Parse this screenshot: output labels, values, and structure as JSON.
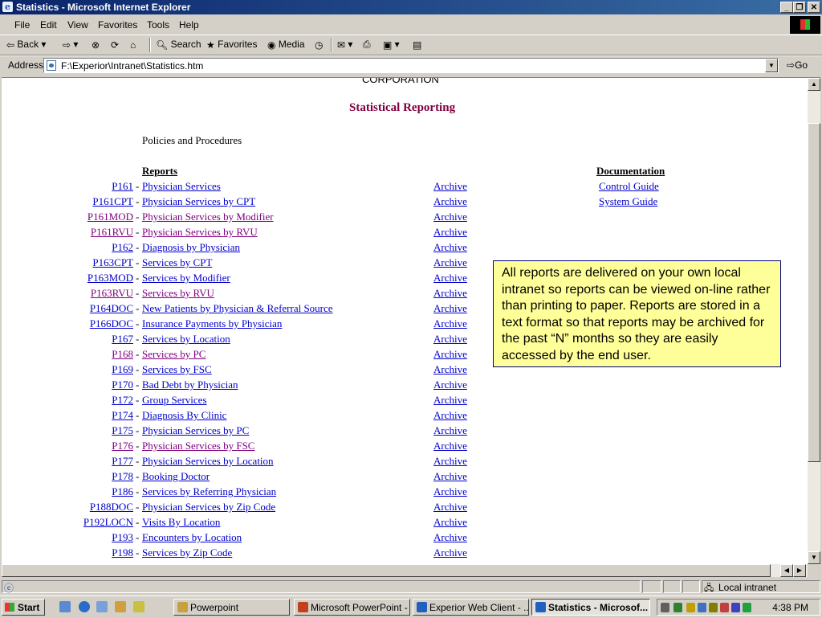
{
  "window": {
    "title": "Statistics - Microsoft Internet Explorer"
  },
  "menu": [
    "File",
    "Edit",
    "View",
    "Favorites",
    "Tools",
    "Help"
  ],
  "toolbar": {
    "back": "Back",
    "search": "Search",
    "favorites": "Favorites",
    "media": "Media"
  },
  "address": {
    "label": "Address",
    "value": "F:\\Experior\\Intranet\\Statistics.htm",
    "go": "Go"
  },
  "page": {
    "corporation": "CORPORATION",
    "title": "Statistical Reporting",
    "policies": "Policies and Procedures",
    "reports_header": "Reports",
    "documentation_header": "Documentation",
    "documentation": [
      "Control Guide",
      "System Guide"
    ],
    "archive_label": "Archive",
    "reports": [
      {
        "code": "P161",
        "name": "Physician Services",
        "visited": false
      },
      {
        "code": "P161CPT",
        "name": "Physician Services by CPT",
        "visited": false
      },
      {
        "code": "P161MOD",
        "name": "Physician Services by Modifier",
        "visited": true
      },
      {
        "code": "P161RVU",
        "name": "Physician Services by RVU",
        "visited": true
      },
      {
        "code": "P162",
        "name": "Diagnosis by Physician",
        "visited": false
      },
      {
        "code": "P163CPT",
        "name": "Services by CPT",
        "visited": false
      },
      {
        "code": "P163MOD",
        "name": "Services by Modifier",
        "visited": false
      },
      {
        "code": "P163RVU",
        "name": "Services by RVU",
        "visited": true
      },
      {
        "code": "P164DOC",
        "name": "New Patients by Physician & Referral Source",
        "visited": false
      },
      {
        "code": "P166DOC",
        "name": "Insurance Payments by Physician",
        "visited": false
      },
      {
        "code": "P167",
        "name": "Services by Location",
        "visited": false
      },
      {
        "code": "P168 ",
        "name": "Services by PC",
        "visited": true
      },
      {
        "code": "P169",
        "name": "Services by FSC",
        "visited": false
      },
      {
        "code": "P170",
        "name": "Bad Debt by Physician",
        "visited": false
      },
      {
        "code": "P172",
        "name": "Group Services",
        "visited": false
      },
      {
        "code": "P174",
        "name": "Diagnosis By Clinic",
        "visited": false
      },
      {
        "code": "P175",
        "name": "Physician Services by PC",
        "visited": false
      },
      {
        "code": "P176",
        "name": "Physician Services by FSC",
        "visited": true
      },
      {
        "code": "P177",
        "name": "Physician Services by Location",
        "visited": false
      },
      {
        "code": "P178",
        "name": "Booking Doctor",
        "visited": false
      },
      {
        "code": "P186",
        "name": "Services by Referring Physician",
        "visited": false
      },
      {
        "code": "P188DOC",
        "name": "Physician Services by Zip Code",
        "visited": false
      },
      {
        "code": "P192LOCN",
        "name": "Visits By Location",
        "visited": false
      },
      {
        "code": "P193",
        "name": "Encounters by Location",
        "visited": false
      },
      {
        "code": "P198",
        "name": "Services by Zip Code",
        "visited": false
      }
    ],
    "callout": "All reports are delivered on your own local intranet so reports can be viewed on-line rather than printing to paper.  Reports are stored in a text format so that reports may be archived for the past “N” months so they are easily accessed by the end user."
  },
  "status": {
    "zone": "Local intranet"
  },
  "taskbar": {
    "start": "Start",
    "tasks": [
      {
        "label": "Powerpoint",
        "color": "#c8a040",
        "active": false
      },
      {
        "label": "Microsoft PowerPoint - ...",
        "color": "#c04020",
        "active": false
      },
      {
        "label": "Experior Web Client - ...",
        "color": "#2060c0",
        "active": false
      },
      {
        "label": "Statistics - Microsof...",
        "color": "#2060c0",
        "active": true
      }
    ],
    "clock": "4:38 PM"
  }
}
